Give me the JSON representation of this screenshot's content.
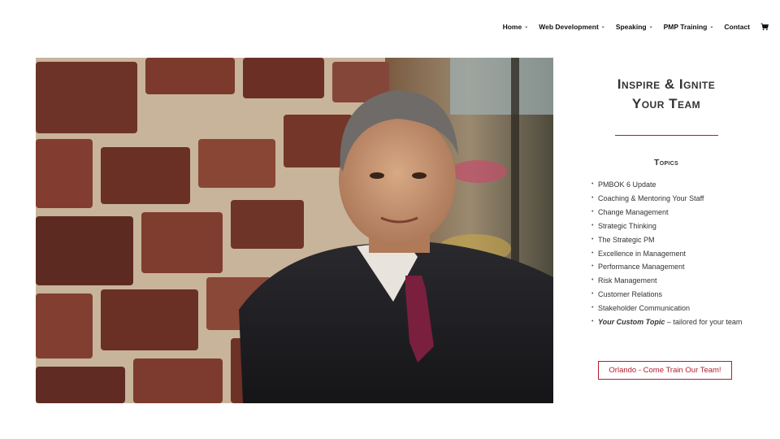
{
  "nav": {
    "items": [
      {
        "label": "Home",
        "has_dropdown": true
      },
      {
        "label": "Web Development",
        "has_dropdown": true
      },
      {
        "label": "Speaking",
        "has_dropdown": true
      },
      {
        "label": "PMP Training",
        "has_dropdown": true
      },
      {
        "label": "Contact",
        "has_dropdown": false
      }
    ],
    "cart_icon": "shopping-cart-icon"
  },
  "hero": {
    "image": "portrait of man in suit leaning against brick wall"
  },
  "side": {
    "headline_line1": "Inspire & Ignite",
    "headline_line2": "Your Team",
    "topics_title": "Topics",
    "topics": [
      "PMBOK 6 Update",
      "Coaching & Mentoring Your Staff",
      "Change Management",
      "Strategic Thinking",
      "The Strategic PM",
      "Excellence in Management",
      "Performance Management",
      "Risk Management",
      "Customer Relations",
      "Stakeholder Communication"
    ],
    "custom_topic_bold": "Your Custom Topic",
    "custom_topic_rest": " – tailored for your team",
    "cta_label": "Orlando - Come Train Our Team!"
  },
  "colors": {
    "accent": "#b11e2e",
    "text": "#333333",
    "background": "#ffffff"
  }
}
